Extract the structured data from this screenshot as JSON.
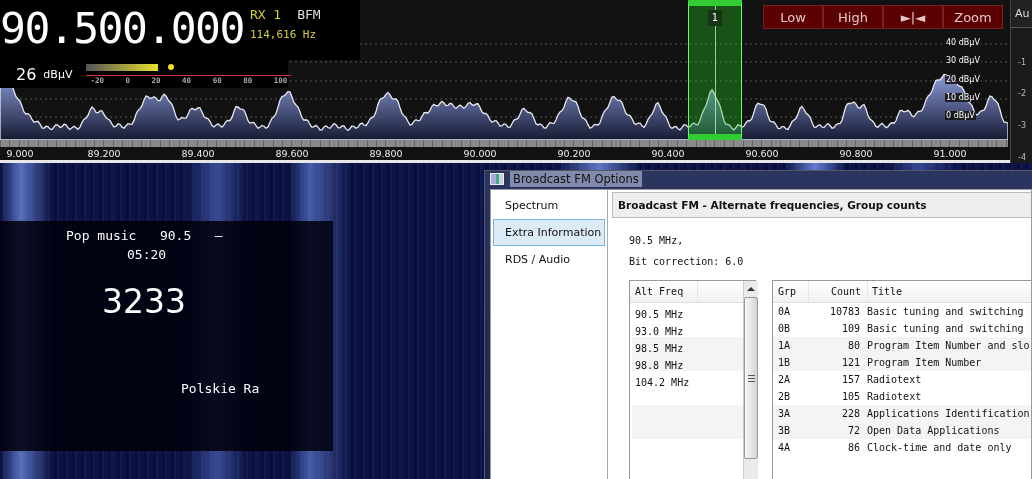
{
  "readout": {
    "frequency": "90.500.000",
    "receiver": "RX 1",
    "mode": "BFM",
    "offset": "114,616 Hz"
  },
  "signal_meter": {
    "value": "26",
    "unit": "dBµV",
    "level": 0.36,
    "scale": [
      "-20",
      "0",
      "20",
      "40",
      "60",
      "80",
      "100"
    ]
  },
  "spectrum": {
    "db_labels": [
      "40 dBµV",
      "30 dBµV",
      "20 dBµV",
      "10 dBµV",
      "0 dBµV"
    ],
    "freq_labels": [
      "9.000",
      "89.200",
      "89.400",
      "89.600",
      "89.800",
      "90.000",
      "90.200",
      "90.400",
      "90.600",
      "90.800",
      "91.000"
    ],
    "filter_marker": {
      "label": "1"
    }
  },
  "toolbar": {
    "buttons": [
      "Low",
      "High",
      "►|◄",
      "Zoom"
    ]
  },
  "side_panel": {
    "button": "Au",
    "labels": [
      "-1",
      "-2",
      "-3",
      "-4"
    ]
  },
  "rds_overlay": {
    "line1": "Pop music   90.5   –",
    "line2": "05:20",
    "pi_code": "3233",
    "station": "Polskie Ra"
  },
  "dialog": {
    "title": "Broadcast FM Options",
    "nav": [
      {
        "label": "Spectrum",
        "selected": false
      },
      {
        "label": "Extra Information",
        "selected": true
      },
      {
        "label": "RDS / Audio",
        "selected": false
      }
    ],
    "header": "Broadcast FM - Alternate frequencies, Group counts",
    "info": [
      "90.5 MHz,",
      "Bit correction: 6.0"
    ],
    "alt_freq": {
      "column": "Alt Freq",
      "rows": [
        "90.5 MHz",
        "93.0 MHz",
        "98.5 MHz",
        "98.8 MHz",
        "104.2 MHz"
      ]
    },
    "groups": {
      "columns": [
        "Grp",
        "Count",
        "Title"
      ],
      "rows": [
        [
          "0A",
          "10783",
          "Basic tuning and switching"
        ],
        [
          "0B",
          "109",
          "Basic tuning and switching"
        ],
        [
          "1A",
          "80",
          "Program Item Number and slo"
        ],
        [
          "1B",
          "121",
          "Program Item Number"
        ],
        [
          "2A",
          "157",
          "Radiotext"
        ],
        [
          "2B",
          "105",
          "Radiotext"
        ],
        [
          "3A",
          "228",
          "Applications Identification"
        ],
        [
          "3B",
          "72",
          "Open Data Applications"
        ],
        [
          "4A",
          "86",
          "Clock-time and date only"
        ]
      ]
    }
  }
}
